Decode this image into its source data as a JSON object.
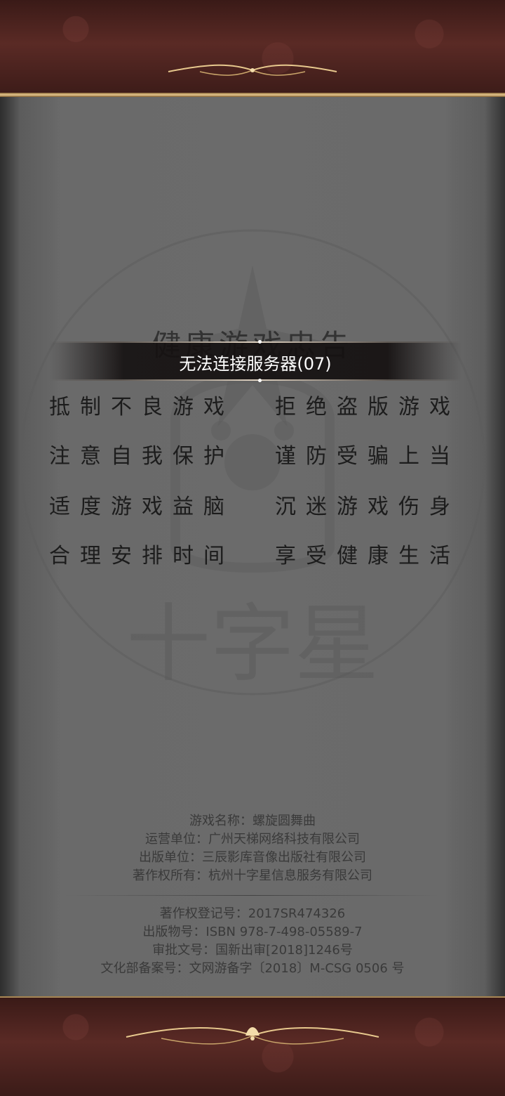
{
  "notice": {
    "title": "健康游戏忠告",
    "left_lines": [
      "抵制不良游戏",
      "注意自我保护",
      "适度游戏益脑",
      "合理安排时间"
    ],
    "right_lines": [
      "拒绝盗版游戏",
      "谨防受骗上当",
      "沉迷游戏伤身",
      "享受健康生活"
    ]
  },
  "toast": {
    "message": "无法连接服务器(07)"
  },
  "watermark_text": "十字星",
  "game_info": [
    "游戏名称：螺旋圆舞曲",
    "运营单位：广州天梯网络科技有限公司",
    "出版单位：三辰影库音像出版社有限公司",
    "著作权所有：杭州十字星信息服务有限公司"
  ],
  "registration_info": [
    "著作权登记号：2017SR474326",
    "出版物号：ISBN 978-7-498-05589-7",
    "审批文号：国新出审[2018]1246号",
    "文化部备案号：文网游备字〔2018〕M-CSG 0506 号"
  ],
  "colors": {
    "toast_bg": "#1a1414",
    "gold": "#e8c98e",
    "roller": "#4a221e",
    "parchment": "#6b6b6b"
  }
}
